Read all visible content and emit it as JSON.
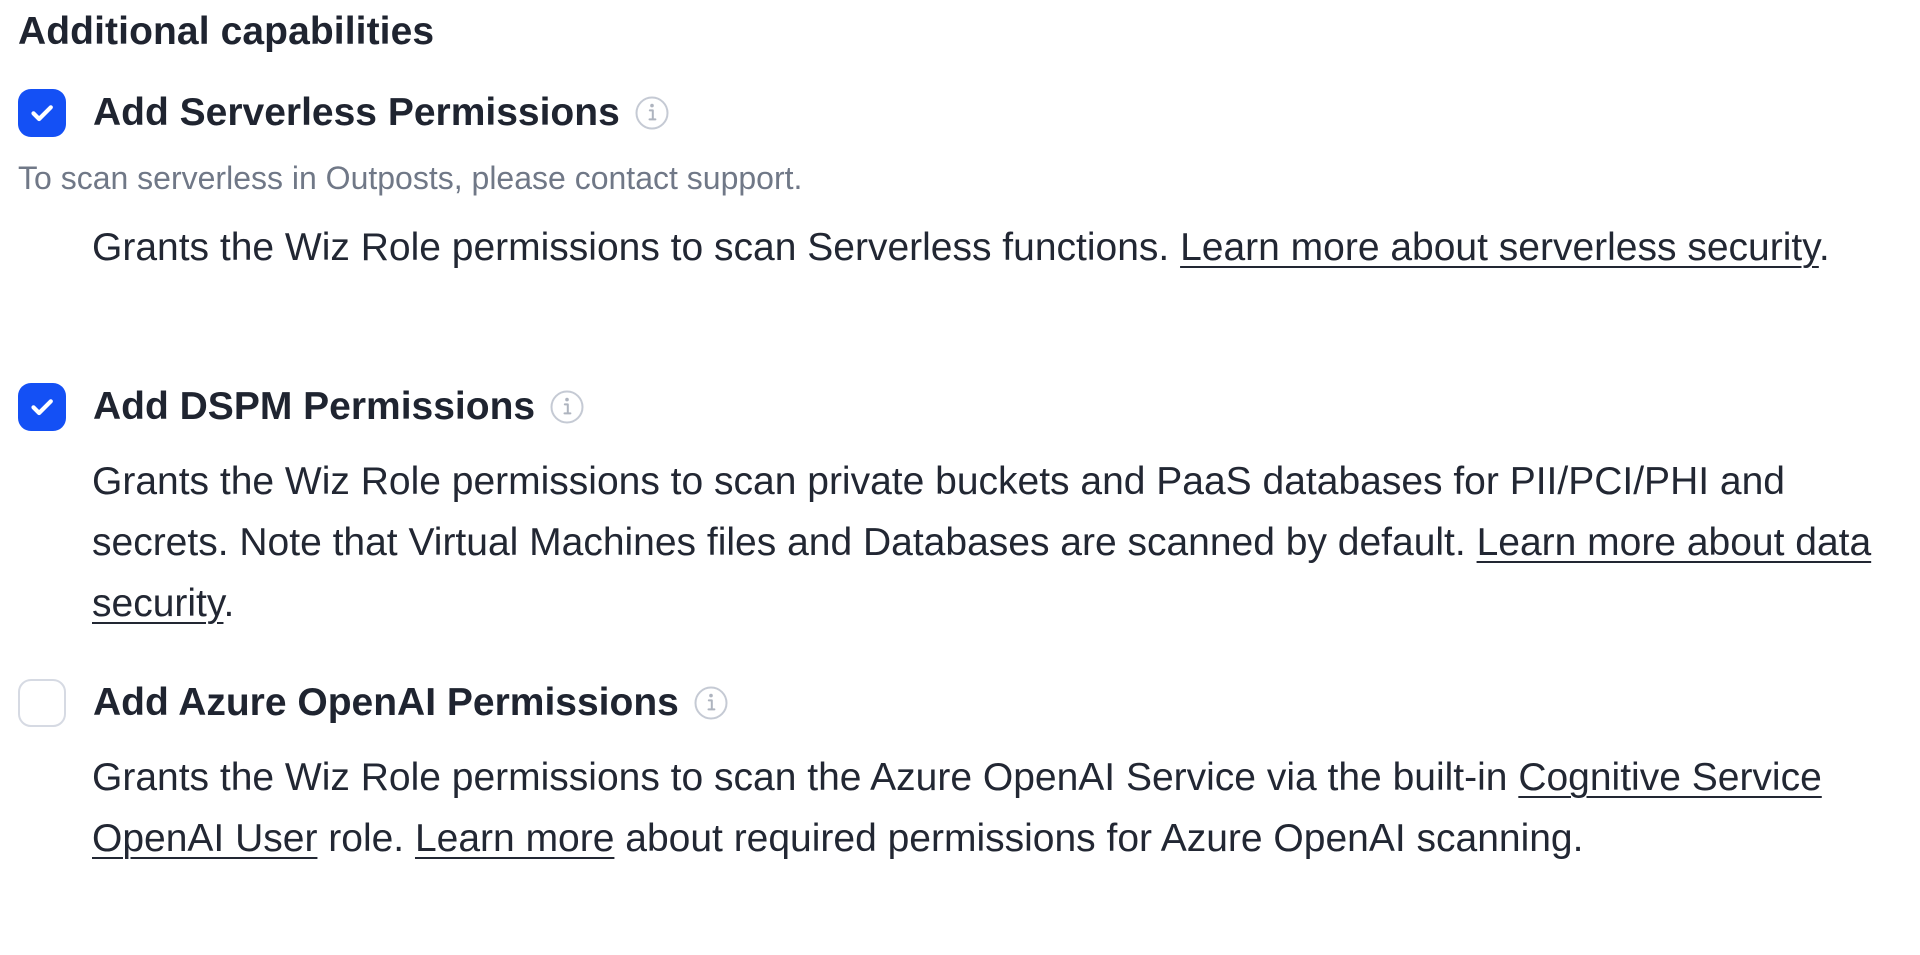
{
  "section": {
    "title": "Additional capabilities"
  },
  "colors": {
    "checked_checkbox": "#1450f5",
    "checkbox_border": "#d6dae3",
    "muted_text": "#707887",
    "primary_text": "#222733"
  },
  "capabilities": [
    {
      "title": "Add Serverless Permissions",
      "checked": true,
      "icon": "info-icon",
      "note": "To scan serverless in Outposts, please contact support.",
      "description": {
        "before_link": "Grants the Wiz Role permissions to scan Serverless functions. ",
        "link": "Learn more about serverless security",
        "after_link": "."
      }
    },
    {
      "title": "Add DSPM Permissions",
      "checked": true,
      "icon": "info-icon",
      "description": {
        "before_link": "Grants the Wiz Role permissions to scan private buckets and PaaS databases for PII/PCI/PHI and secrets. Note that Virtual Machines files and Databases are scanned by default. ",
        "link": "Learn more about data security",
        "after_link": "."
      }
    },
    {
      "title": "Add Azure OpenAI Permissions",
      "checked": false,
      "icon": "info-icon",
      "description": {
        "before_first_link": "Grants the Wiz Role permissions to scan the Azure OpenAI Service via the built-in ",
        "first_link": "Cognitive Service OpenAI User",
        "between_links": " role. ",
        "second_link": "Learn more",
        "after_second_link": " about required permissions for Azure OpenAI scanning."
      }
    }
  ]
}
